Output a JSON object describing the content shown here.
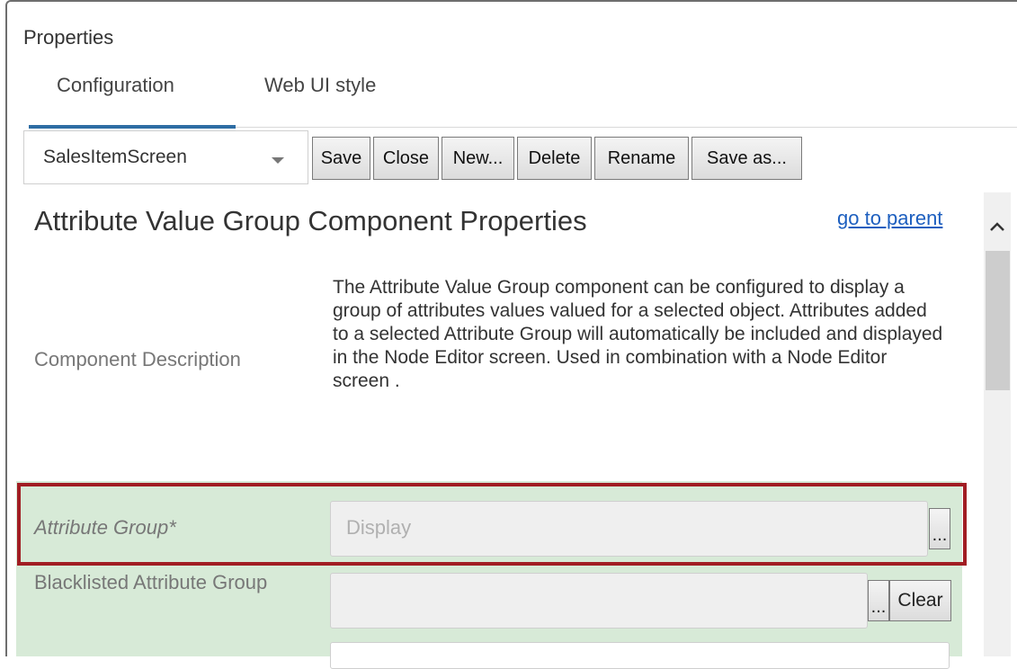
{
  "panel": {
    "title": "Properties"
  },
  "tabs": [
    {
      "label": "Configuration",
      "active": true
    },
    {
      "label": "Web UI style",
      "active": false
    }
  ],
  "toolbar": {
    "screen_select_value": "SalesItemScreen",
    "buttons": {
      "save": "Save",
      "close": "Close",
      "new": "New...",
      "delete": "Delete",
      "rename": "Rename",
      "save_as": "Save as..."
    }
  },
  "component": {
    "heading": "Attribute Value Group Component Properties",
    "go_to_parent": "go to parent",
    "description_label": "Component Description",
    "description_text": "The Attribute Value Group component can be configured to display a group of attributes values valued for a selected object. Attributes added to a selected Attribute Group will automatically be included and displayed in the Node Editor screen. Used in combination with a Node Editor screen ."
  },
  "fields": {
    "attribute_group": {
      "label": "Attribute Group*",
      "placeholder": "Display",
      "browse_label": "..."
    },
    "blacklisted_attribute_group": {
      "label": "Blacklisted Attribute Group",
      "browse_label": "...",
      "clear_label": "Clear"
    }
  },
  "colors": {
    "accent": "#2e6da4",
    "link": "#1d5fbf",
    "highlight_border": "#a11d23",
    "field_band": "#d7ead7"
  },
  "icons": {
    "dropdown": "chevron-down-icon",
    "scroll_up": "chevron-up-icon"
  }
}
